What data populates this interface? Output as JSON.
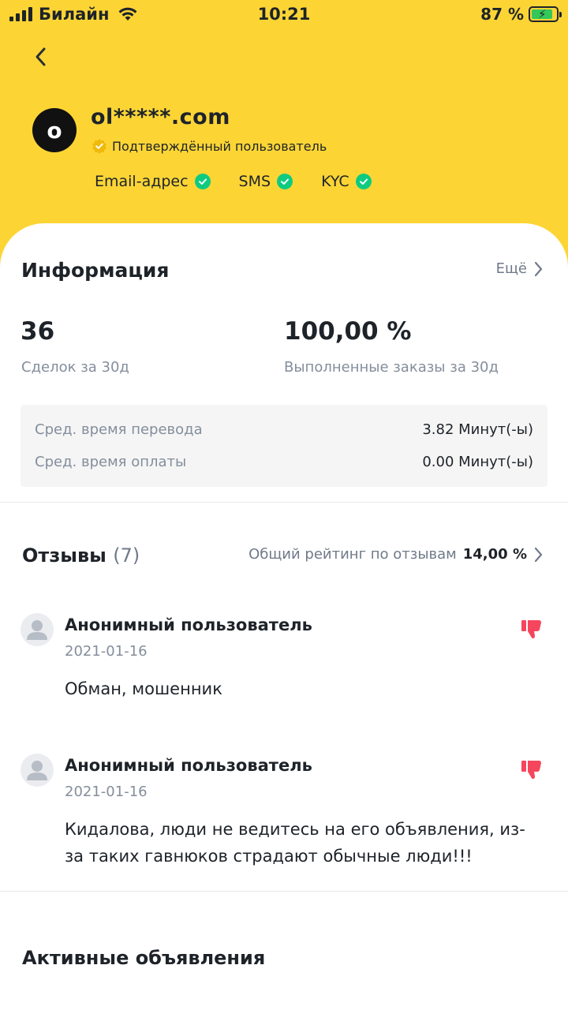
{
  "status_bar": {
    "carrier": "Билайн",
    "time": "10:21",
    "battery": "87 %"
  },
  "profile": {
    "avatar_letter": "o",
    "name": "ol*****.com",
    "verified_label": "Подтверждённый пользователь",
    "verifications": [
      {
        "label": "Email-адрес"
      },
      {
        "label": "SMS"
      },
      {
        "label": "KYC"
      }
    ]
  },
  "info": {
    "title": "Информация",
    "more": "Ещё",
    "deals_value": "36",
    "deals_label": "Сделок за 30д",
    "completion_value": "100,00 %",
    "completion_label": "Выполненные заказы за 30д",
    "transfer_label": "Сред. время перевода",
    "transfer_value": "3.82 Минут(-ы)",
    "payment_label": "Сред. время оплаты",
    "payment_value": "0.00 Минут(-ы)"
  },
  "reviews": {
    "title": "Отзывы",
    "count": "(7)",
    "rating_label": "Общий рейтинг по отзывам",
    "rating_value": "14,00 %",
    "items": [
      {
        "author": "Анонимный пользователь",
        "date": "2021-01-16",
        "text": "Обман, мошенник"
      },
      {
        "author": "Анонимный пользователь",
        "date": "2021-01-16",
        "text": "Кидалова, люди не ведитесь на его объявления, из-за таких гавнюков страдают обычные люди!!!"
      }
    ]
  },
  "active_ads": {
    "title": "Активные объявления"
  },
  "colors": {
    "brand_yellow": "#FCD535",
    "success_green": "#0ECB81",
    "negative_red": "#F6465D"
  }
}
